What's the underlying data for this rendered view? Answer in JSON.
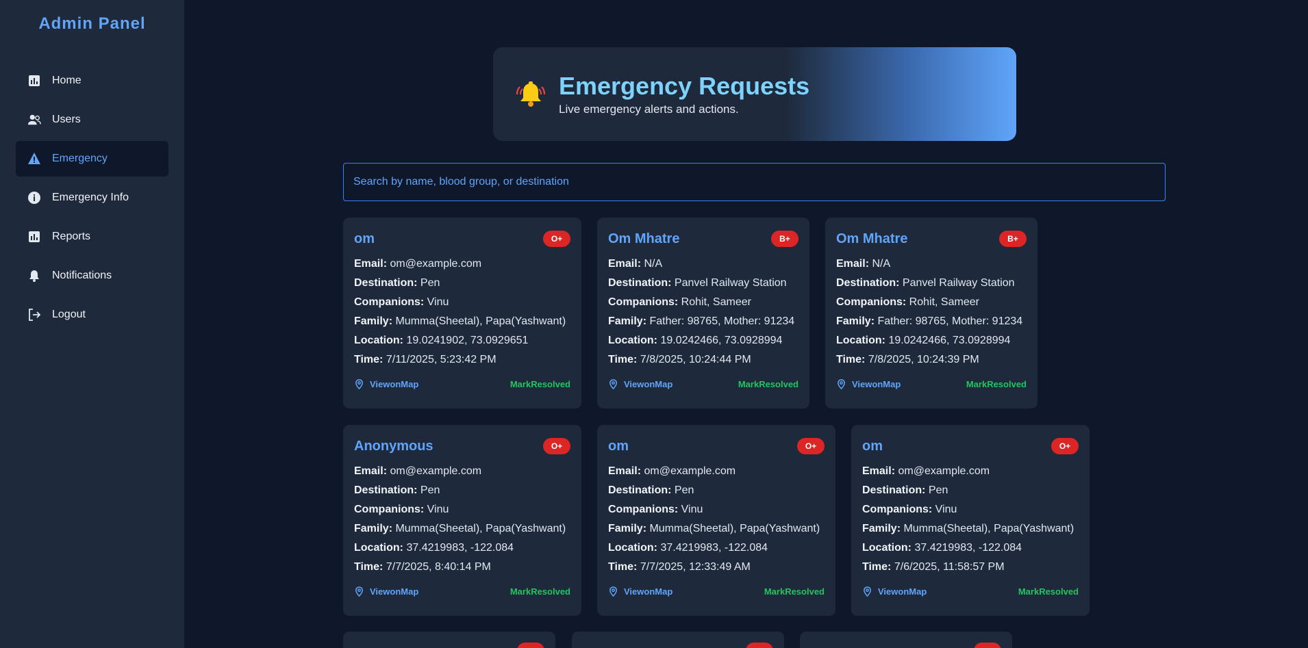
{
  "sidebar": {
    "brand": "Admin Panel",
    "items": [
      {
        "label": "Home",
        "icon": "chart-icon"
      },
      {
        "label": "Users",
        "icon": "users-icon"
      },
      {
        "label": "Emergency",
        "icon": "warning-icon",
        "active": true
      },
      {
        "label": "Emergency Info",
        "icon": "info-icon"
      },
      {
        "label": "Reports",
        "icon": "chart-icon"
      },
      {
        "label": "Notifications",
        "icon": "bell-icon"
      },
      {
        "label": "Logout",
        "icon": "logout-icon"
      }
    ]
  },
  "header": {
    "title": "Emergency Requests",
    "subtitle": "Live emergency alerts and actions.",
    "icon": "alarm-bell-icon"
  },
  "search": {
    "placeholder": "Search by name, blood group, or destination",
    "value": ""
  },
  "labels": {
    "email": "Email:",
    "destination": "Destination:",
    "companions": "Companions:",
    "family": "Family:",
    "location": "Location:",
    "time": "Time:",
    "view_map": "ViewonMap",
    "mark_resolved": "MarkResolved"
  },
  "colors": {
    "accent": "#60a5fa",
    "badge": "#dc2626",
    "resolve": "#22c55e",
    "background": "#0f172a",
    "panel": "#1e293b"
  },
  "cards": [
    {
      "name": "om",
      "blood_group": "O+",
      "email": "om@example.com",
      "destination": "Pen",
      "companions": "Vinu",
      "family": "Mumma(Sheetal), Papa(Yashwant)",
      "location": "19.0241902, 73.0929651",
      "time": "7/11/2025, 5:23:42 PM"
    },
    {
      "name": "Om Mhatre",
      "blood_group": "B+",
      "email": "N/A",
      "destination": "Panvel Railway Station",
      "companions": "Rohit, Sameer",
      "family": "Father: 98765, Mother: 91234",
      "location": "19.0242466, 73.0928994",
      "time": "7/8/2025, 10:24:44 PM"
    },
    {
      "name": "Om Mhatre",
      "blood_group": "B+",
      "email": "N/A",
      "destination": "Panvel Railway Station",
      "companions": "Rohit, Sameer",
      "family": "Father: 98765, Mother: 91234",
      "location": "19.0242466, 73.0928994",
      "time": "7/8/2025, 10:24:39 PM"
    },
    {
      "name": "Anonymous",
      "blood_group": "O+",
      "email": "om@example.com",
      "destination": "Pen",
      "companions": "Vinu",
      "family": "Mumma(Sheetal), Papa(Yashwant)",
      "location": "37.4219983, -122.084",
      "time": "7/7/2025, 8:40:14 PM"
    },
    {
      "name": "om",
      "blood_group": "O+",
      "email": "om@example.com",
      "destination": "Pen",
      "companions": "Vinu",
      "family": "Mumma(Sheetal), Papa(Yashwant)",
      "location": "37.4219983, -122.084",
      "time": "7/7/2025, 12:33:49 AM"
    },
    {
      "name": "om",
      "blood_group": "O+",
      "email": "om@example.com",
      "destination": "Pen",
      "companions": "Vinu",
      "family": "Mumma(Sheetal), Papa(Yashwant)",
      "location": "37.4219983, -122.084",
      "time": "7/6/2025, 11:58:57 PM"
    }
  ]
}
